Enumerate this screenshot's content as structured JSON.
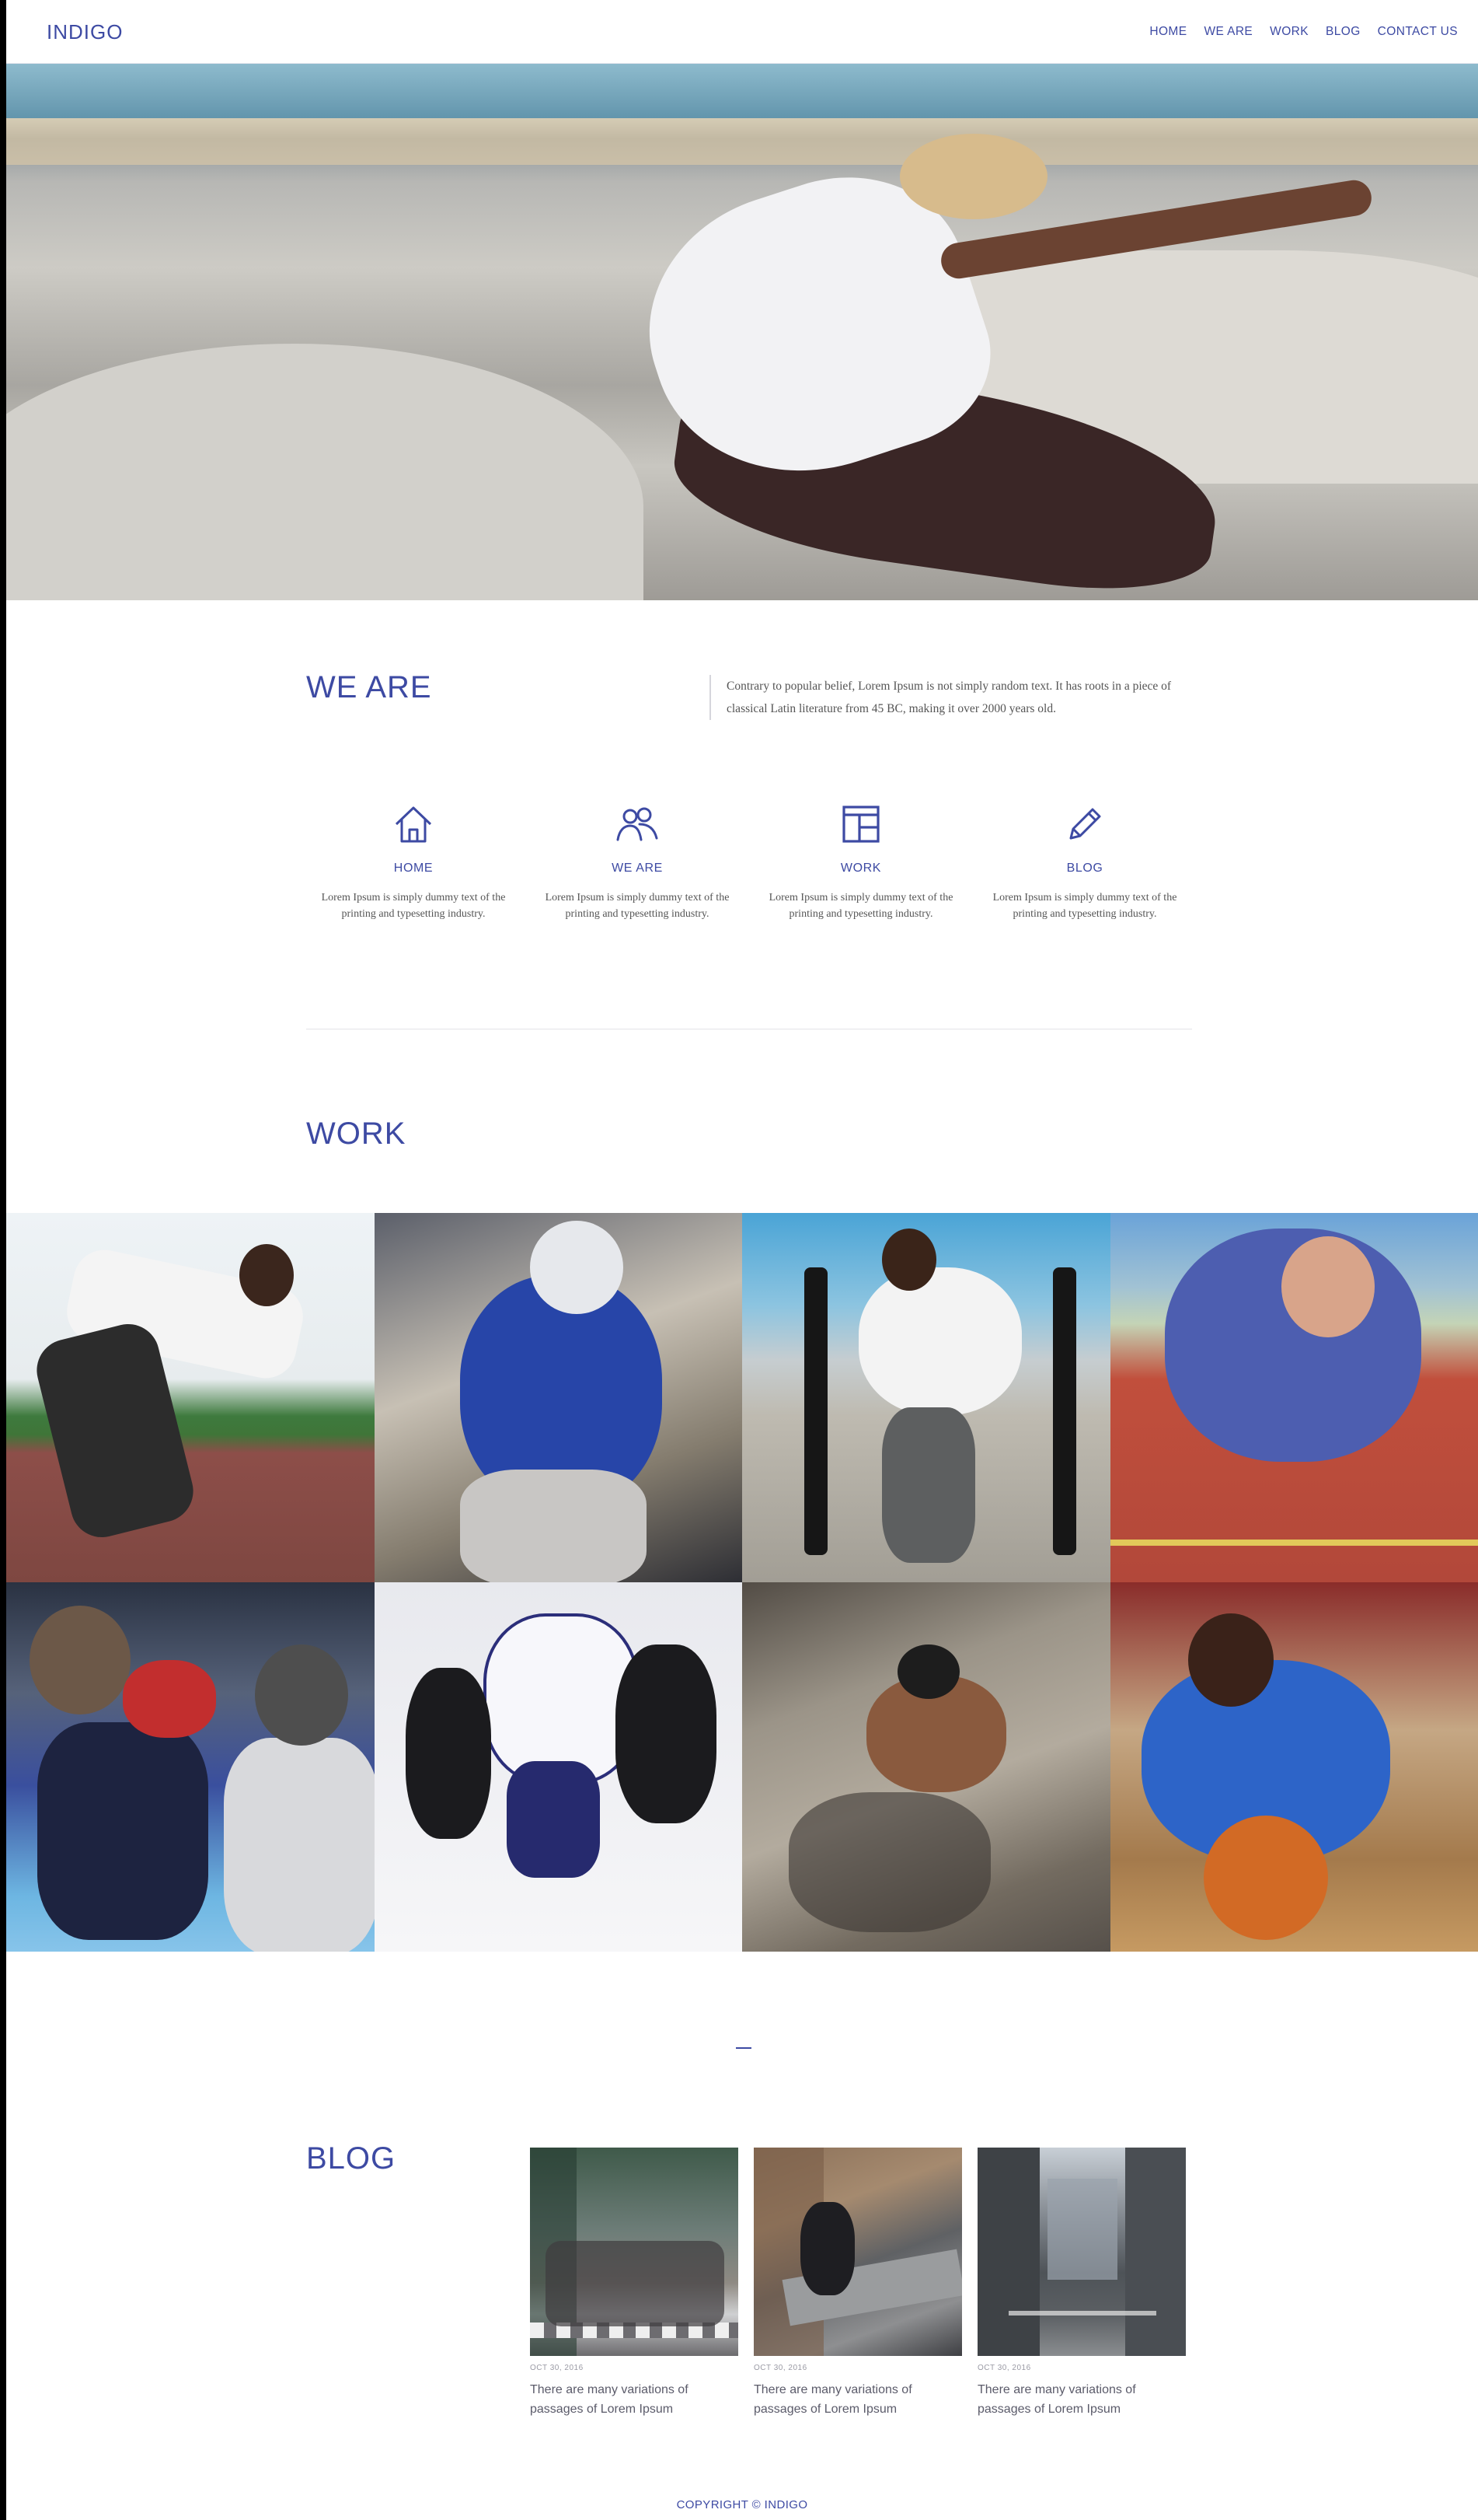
{
  "brand": {
    "logo": "INDIGO",
    "accent": "#3d4aa3"
  },
  "nav": {
    "items": [
      "HOME",
      "WE ARE",
      "WORK",
      "BLOG",
      "CONTACT US"
    ]
  },
  "weare": {
    "title": "WE ARE",
    "description": "Contrary to popular belief, Lorem Ipsum is not simply random text. It has roots in a piece of classical Latin literature from 45 BC, making it over 2000 years old.",
    "features": [
      {
        "icon": "home-icon",
        "title": "HOME",
        "text": "Lorem Ipsum is simply dummy text of the printing and typesetting industry."
      },
      {
        "icon": "users-icon",
        "title": "WE ARE",
        "text": "Lorem Ipsum is simply dummy text of the printing and typesetting industry."
      },
      {
        "icon": "layout-icon",
        "title": "WORK",
        "text": "Lorem Ipsum is simply dummy text of the printing and typesetting industry."
      },
      {
        "icon": "pencil-icon",
        "title": "BLOG",
        "text": "Lorem Ipsum is simply dummy text of the printing and typesetting industry."
      }
    ]
  },
  "work": {
    "title": "WORK"
  },
  "blog": {
    "title": "BLOG",
    "posts": [
      {
        "date": "OCT 30, 2016",
        "title": "There are many variations of passages of Lorem Ipsum"
      },
      {
        "date": "OCT 30, 2016",
        "title": "There are many variations of passages of Lorem Ipsum"
      },
      {
        "date": "OCT 30, 2016",
        "title": "There are many variations of passages of Lorem Ipsum"
      }
    ]
  },
  "footer": {
    "copyright": "COPYRIGHT © INDIGO"
  }
}
